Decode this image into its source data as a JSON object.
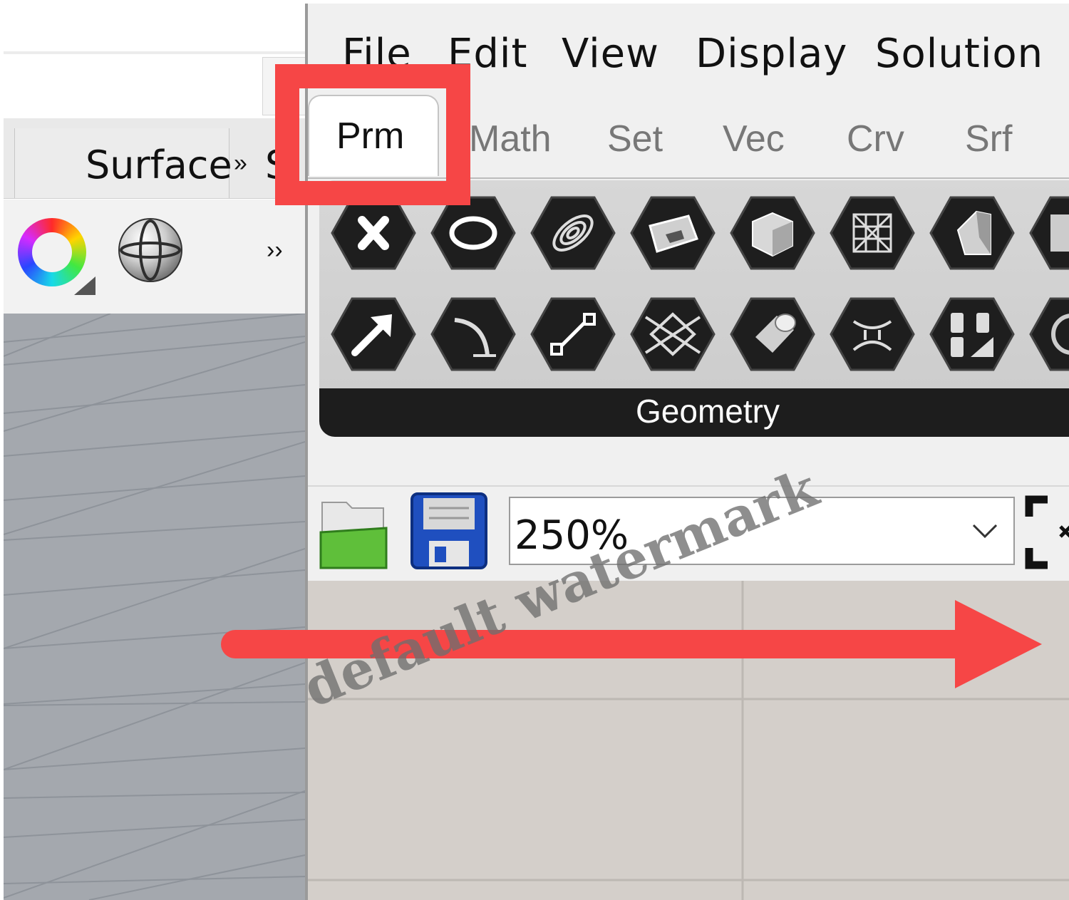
{
  "rhino": {
    "ribbon_tab_label": "Surface",
    "ribbon_tab_cut_label": "S",
    "overflow_label": "»",
    "toolbar_overflow_label": "››"
  },
  "grasshopper": {
    "menu": [
      "File",
      "Edit",
      "View",
      "Display",
      "Solution"
    ],
    "tabs": [
      {
        "label": "Prm",
        "active": true
      },
      {
        "label": "Math"
      },
      {
        "label": "Set"
      },
      {
        "label": "Vec"
      },
      {
        "label": "Crv"
      },
      {
        "label": "Srf"
      }
    ],
    "palette": {
      "group_label": "Geometry",
      "row1_icons": [
        "delete-x-icon",
        "circle-icon",
        "spiral-icon",
        "surface-icon",
        "box-icon",
        "mesh-icon",
        "brep-icon",
        "panel-icon"
      ],
      "row2_icons": [
        "vector-arrow-icon",
        "arc-icon",
        "line-icon",
        "plane-icon",
        "cylinder-icon",
        "twisted-box-icon",
        "text-abc-icon",
        "spiral-circle-icon"
      ]
    },
    "canvas_toolbar": {
      "zoom_value": "250%"
    }
  },
  "annotations": {
    "highlight_color": "#f64646",
    "arrow_color": "#f64646",
    "watermark_text": "default watermark"
  }
}
